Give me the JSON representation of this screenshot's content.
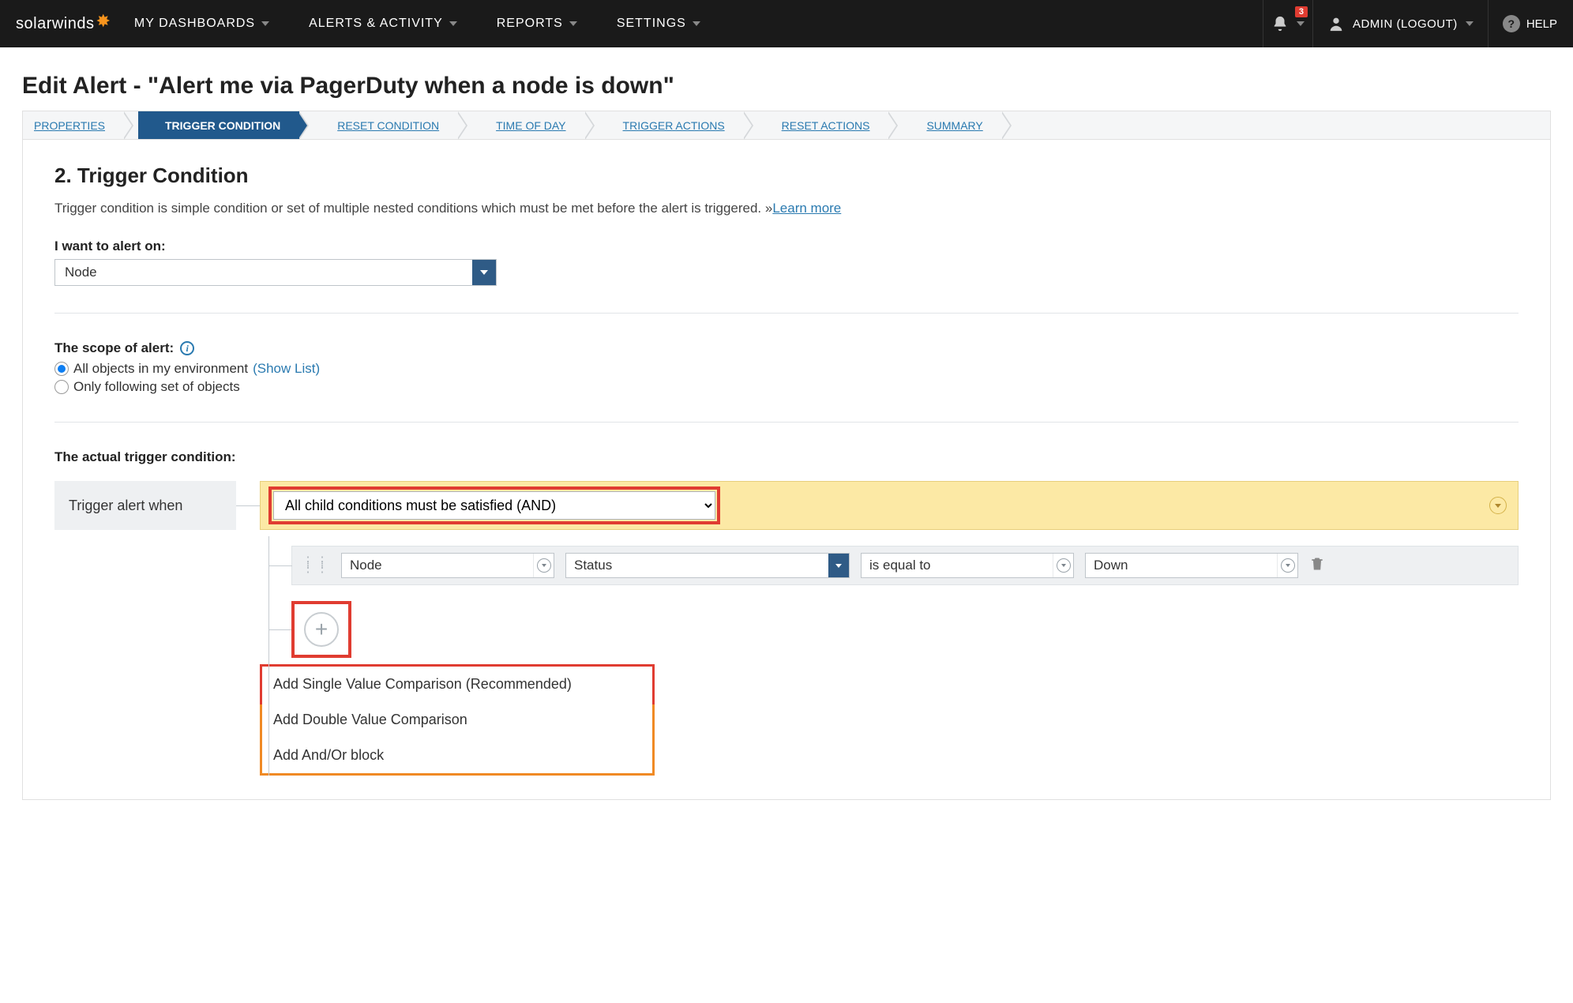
{
  "topnav": {
    "logo": "solarwinds",
    "items": [
      "MY DASHBOARDS",
      "ALERTS & ACTIVITY",
      "REPORTS",
      "SETTINGS"
    ],
    "badge": "3",
    "user": "ADMIN  (LOGOUT)",
    "help": "HELP"
  },
  "page": {
    "title": "Edit Alert - \"Alert me via PagerDuty when a node is down\""
  },
  "wizard": {
    "steps": [
      "PROPERTIES",
      "TRIGGER CONDITION",
      "RESET CONDITION",
      "TIME OF DAY",
      "TRIGGER ACTIONS",
      "RESET ACTIONS",
      "SUMMARY"
    ],
    "active_index": 1
  },
  "section": {
    "heading": "2. Trigger Condition",
    "description": "Trigger condition is simple condition or set of multiple nested conditions which must be met before the alert is triggered. »",
    "learn_more": "Learn more"
  },
  "alert_on": {
    "label": "I want to alert on:",
    "value": "Node"
  },
  "scope": {
    "label": "The scope of alert:",
    "opt_all": "All objects in my environment",
    "show_list": "(Show List)",
    "opt_only": "Only following set of objects"
  },
  "trigger": {
    "label": "The actual trigger condition:",
    "prefix": "Trigger alert when",
    "mode": "All child conditions must be satisfied (AND)",
    "row": {
      "entity": "Node",
      "field": "Status",
      "op": "is equal to",
      "value": "Down"
    },
    "menu": {
      "item1": "Add Single Value Comparison (Recommended)",
      "item2": "Add Double Value Comparison",
      "item3": "Add And/Or block"
    }
  }
}
